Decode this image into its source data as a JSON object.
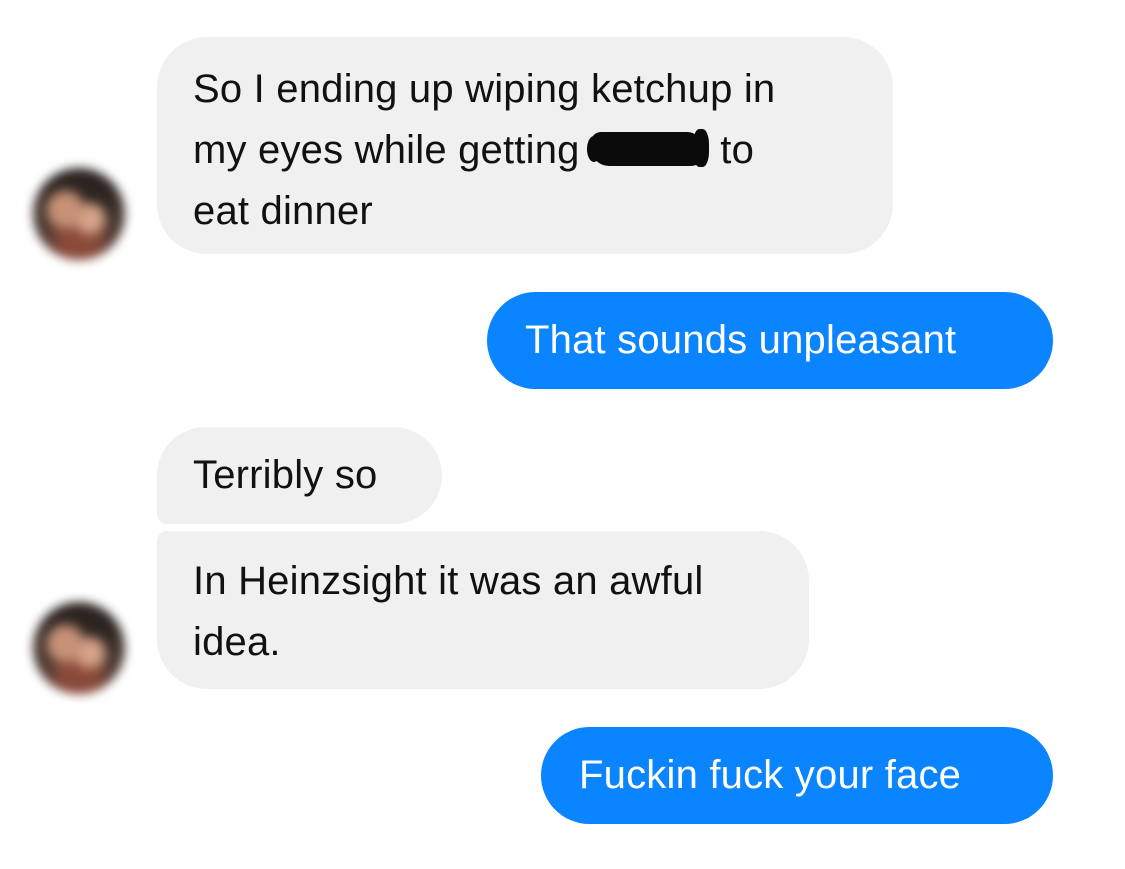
{
  "conversation": {
    "messages": [
      {
        "sender": "other",
        "line1": "So I ending up wiping ketchup in",
        "line2_before": "my eyes while getting",
        "line2_after": "to",
        "line3": "eat dinner"
      },
      {
        "sender": "me",
        "text": "That sounds unpleasant"
      },
      {
        "sender": "other",
        "text": "Terribly so"
      },
      {
        "sender": "other",
        "line1": "In Heinzsight it was an awful",
        "line2": "idea."
      },
      {
        "sender": "me",
        "text": "Fuckin fuck your face"
      }
    ]
  },
  "colors": {
    "incoming_bubble": "#f0f0f0",
    "outgoing_bubble": "#0a84ff",
    "incoming_text": "#111111",
    "outgoing_text": "#ffffff"
  },
  "icons": {
    "avatar": "contact-avatar-blurred",
    "redaction": "scribbled-out-name"
  }
}
